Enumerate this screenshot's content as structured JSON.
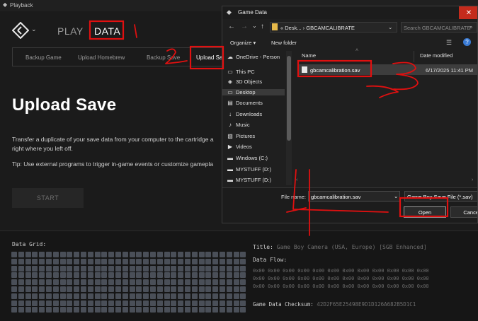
{
  "app": {
    "title": "Playback",
    "nav_play": "PLAY",
    "nav_data": "DATA",
    "subtabs": [
      "Backup Game",
      "Upload Homebrew",
      "Backup Save",
      "Upload Save"
    ],
    "heading": "Upload Save",
    "description_line1": "Transfer a duplicate of your save data from your computer to the cartridge a",
    "description_line2": "right where you left off.",
    "tip": "Tip: Use external programs to trigger in-game events or customize gamepla",
    "start_label": "START",
    "grid_label": "Data Grid:",
    "title_label": "Title:",
    "title_value": "Game Boy Camera (USA, Europe) [SGB Enhanced]",
    "flow_label": "Data Flow:",
    "flow_rows": [
      "0x00 0x00 0x00 0x00 0x00 0x00 0x00 0x00 0x00 0x00 0x00 0x00",
      "0x00 0x00 0x00 0x00 0x00 0x00 0x00 0x00 0x00 0x00 0x00 0x00",
      "0x00 0x00 0x00 0x00 0x00 0x00 0x00 0x00 0x00 0x00 0x00 0x00"
    ],
    "checksum_label": "Game Data Checksum:",
    "checksum_value": "42D2F65E25498E9D1D126A682B5D1C1"
  },
  "dialog": {
    "title": "Game Data",
    "close": "✕",
    "address": "« Desk... › GBCAMCALIBRATE",
    "search_placeholder": "Search GBCAMCALIBRATE",
    "organize": "Organize ▾",
    "new_folder": "New folder",
    "nav_items": [
      {
        "label": "OneDrive - Person",
        "icon": "☁"
      },
      {
        "label": "This PC",
        "icon": "▭"
      },
      {
        "label": "3D Objects",
        "icon": "◈"
      },
      {
        "label": "Desktop",
        "icon": "▭"
      },
      {
        "label": "Documents",
        "icon": "▤"
      },
      {
        "label": "Downloads",
        "icon": "↓"
      },
      {
        "label": "Music",
        "icon": "♪"
      },
      {
        "label": "Pictures",
        "icon": "▧"
      },
      {
        "label": "Videos",
        "icon": "▶"
      },
      {
        "label": "Windows (C:)",
        "icon": "▬"
      },
      {
        "label": "MYSTUFF (D:)",
        "icon": "▬"
      },
      {
        "label": "MYSTUFF (D:)",
        "icon": "▬"
      }
    ],
    "col_name": "Name",
    "col_date": "Date modified",
    "file_name": "gbcamcalibration.sav",
    "file_date": "6/17/2025 11:41 PM",
    "filename_label": "File name:",
    "filename_value": "gbcamcalibration.sav",
    "filetype_value": "Game Boy Save File (*.sav)",
    "open_label": "Open",
    "cancel_label": "Cancel"
  },
  "annotations": {
    "color": "#e01010",
    "marks": [
      "1",
      "2",
      "3",
      "4"
    ]
  }
}
